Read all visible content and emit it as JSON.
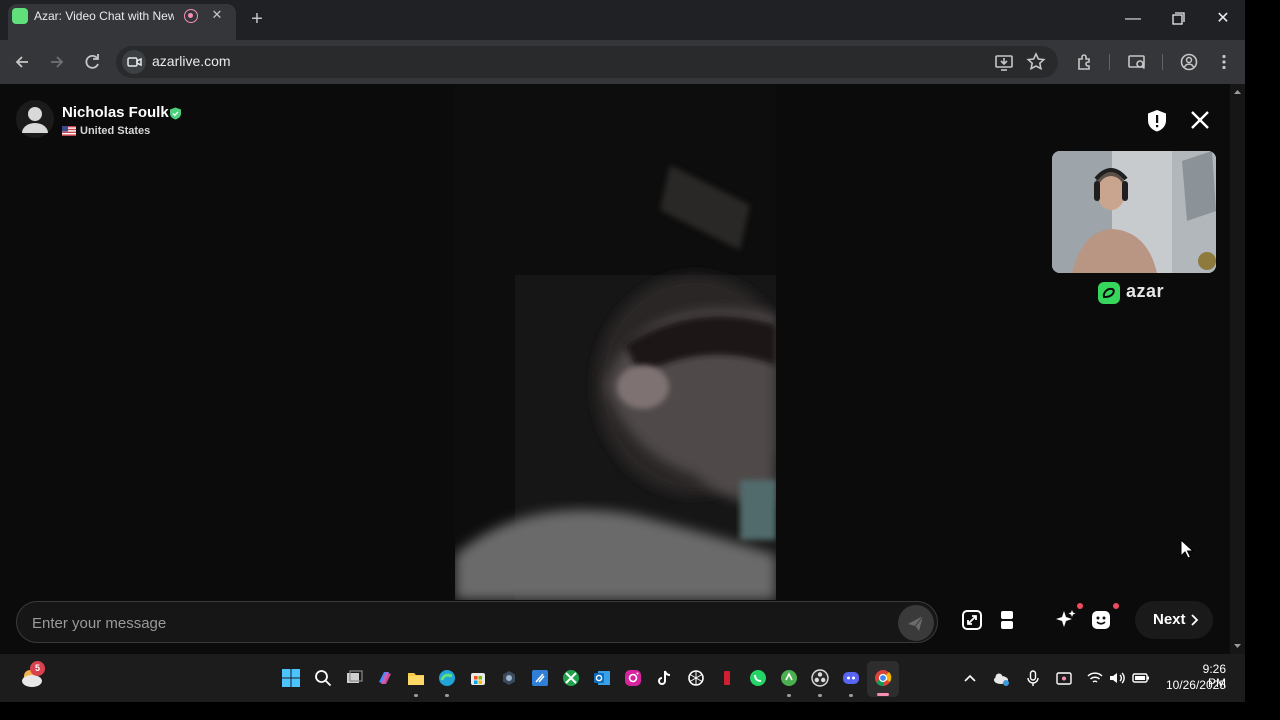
{
  "browser": {
    "tab_title": "Azar: Video Chat with New",
    "url": "azarlive.com"
  },
  "chat": {
    "user_name": "Nicholas Foulk",
    "country": "United States",
    "brand": "azar",
    "message_placeholder": "Enter your message",
    "next_label": "Next"
  },
  "weather_badge": "5",
  "clock": {
    "time": "9:26 PM",
    "date": "10/26/2025"
  },
  "colors": {
    "brand_green": "#36d65c",
    "notification_red": "#ef4b5d"
  }
}
